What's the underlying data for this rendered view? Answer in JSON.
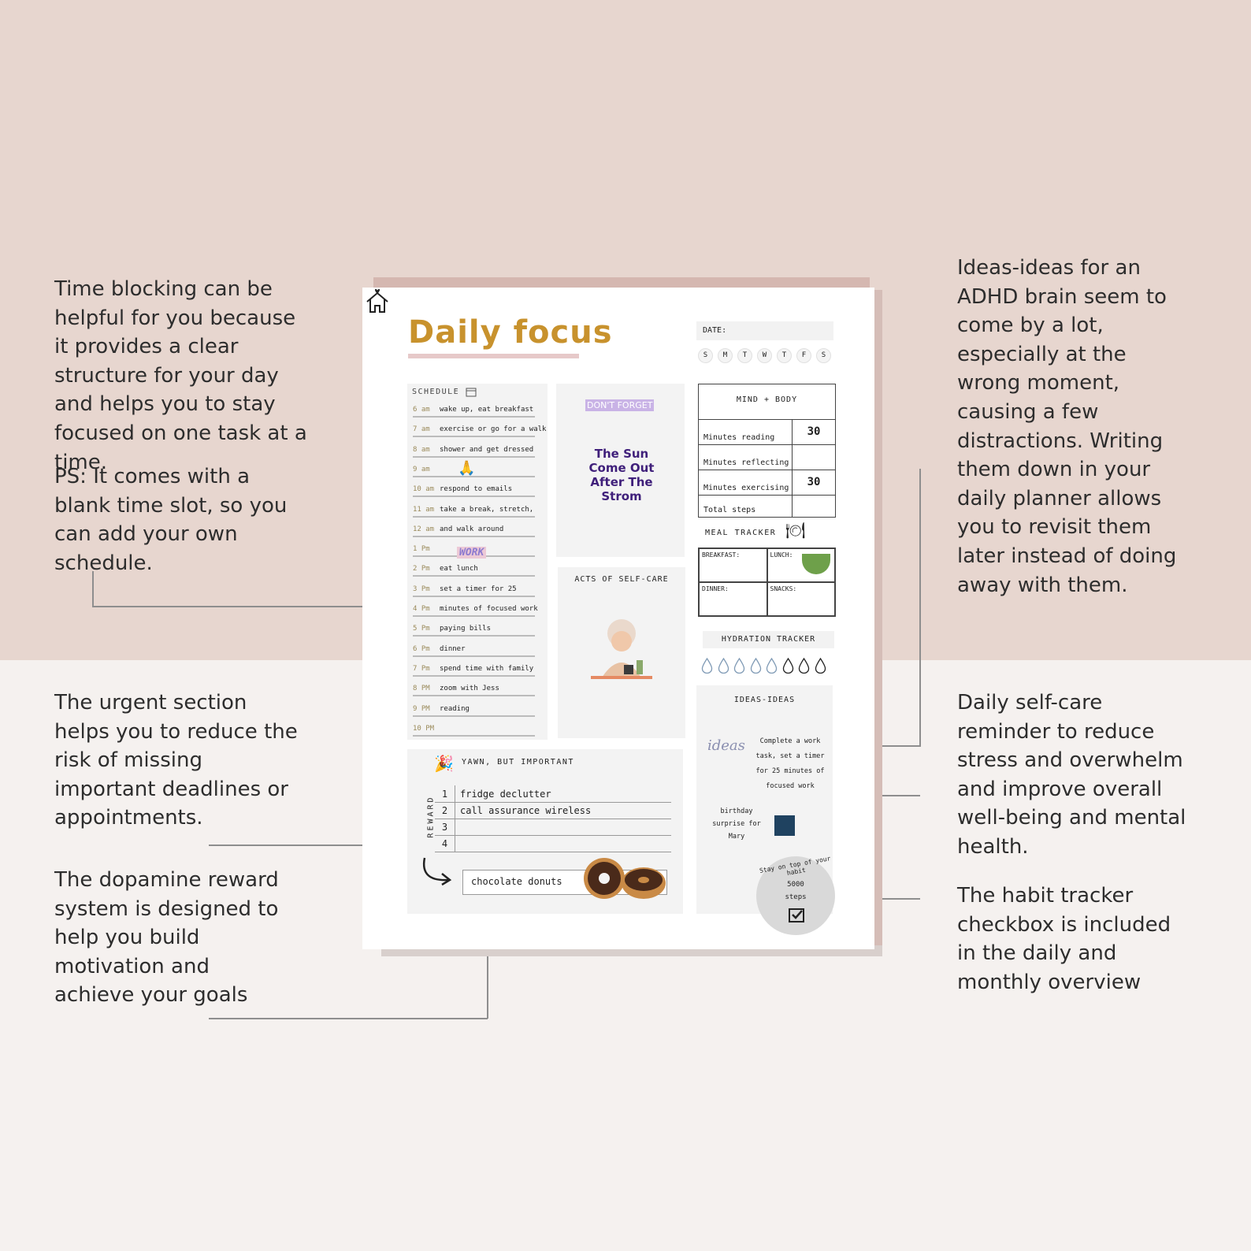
{
  "notes": {
    "time_blocking": "Time blocking can be helpful for you because it provides a clear structure for your day and helps you to stay focused on one task at a time.",
    "ps": "PS: It comes with a blank time slot, so you can add your own schedule.",
    "urgent": "The urgent section helps you to reduce the risk of missing important deadlines or appointments.",
    "dopamine": "The dopamine reward system is designed to help you build motivation and achieve your goals",
    "ideas": "Ideas-ideas for an ADHD brain seem to come by a lot, especially at the wrong moment, causing a few distractions. Writing them down in your daily planner allows you to revisit them later instead of doing away with them.",
    "self_care": "Daily self-care reminder to reduce stress and overwhelm and improve overall well-being and mental health.",
    "habit": "The habit tracker checkbox is included in the daily and monthly overview"
  },
  "planner": {
    "title": "Daily focus",
    "date_label": "DATE:",
    "days": [
      "S",
      "M",
      "T",
      "W",
      "T",
      "F",
      "S"
    ],
    "schedule": {
      "label": "SCHEDULE",
      "rows": [
        {
          "time": "6 am",
          "task": "wake up, eat breakfast"
        },
        {
          "time": "7 am",
          "task": "exercise or go for a walk"
        },
        {
          "time": "8 am",
          "task": "shower and get dressed"
        },
        {
          "time": "9 am",
          "task": ""
        },
        {
          "time": "10 am",
          "task": "respond to emails"
        },
        {
          "time": "11 am",
          "task": "take a break, stretch,"
        },
        {
          "time": "12 am",
          "task": "and walk around"
        },
        {
          "time": "1 Pm",
          "task": ""
        },
        {
          "time": "2 Pm",
          "task": "eat lunch"
        },
        {
          "time": "3 Pm",
          "task": "set a timer for 25"
        },
        {
          "time": "4 Pm",
          "task": "minutes of focused work"
        },
        {
          "time": "5 Pm",
          "task": "paying bills"
        },
        {
          "time": "6 Pm",
          "task": "dinner"
        },
        {
          "time": "7 Pm",
          "task": "spend time with family"
        },
        {
          "time": "8 PM",
          "task": "zoom with Jess"
        },
        {
          "time": "9 PM",
          "task": "reading"
        },
        {
          "time": "10 PM",
          "task": ""
        }
      ],
      "work_sticker": "WORK"
    },
    "dont_forget": {
      "label": "DON'T FORGET",
      "quote": "The Sun Come Out After The Strom"
    },
    "self_care": {
      "label": "ACTS OF SELF-CARE"
    },
    "mind_body": {
      "label": "MIND + BODY",
      "rows": [
        {
          "label": "Minutes reading",
          "value": "30"
        },
        {
          "label": "Minutes reflecting",
          "value": ""
        },
        {
          "label": "Minutes exercising",
          "value": "30"
        },
        {
          "label": "Total steps",
          "value": ""
        }
      ]
    },
    "meal": {
      "label": "MEAL TRACKER",
      "cells": [
        "BREAKFAST:",
        "LUNCH:",
        "DINNER:",
        "SNACKS:"
      ]
    },
    "hydration": {
      "label": "HYDRATION TRACKER",
      "filled": 5,
      "total": 8
    },
    "ideas": {
      "label": "IDEAS-IDEAS",
      "doodle": "ideas",
      "idea1": "Complete a work task, set a timer for 25 minutes of focused work",
      "idea2": "birthday surprise for Mary"
    },
    "habit": {
      "arc": "Stay on top of your habit",
      "value": "5000 steps",
      "checked": true
    },
    "urgent": {
      "label": "YAWN, BUT IMPORTANT",
      "side": "REWARD",
      "rows": [
        {
          "n": "1",
          "text": "fridge declutter"
        },
        {
          "n": "2",
          "text": "call assurance wireless"
        },
        {
          "n": "3",
          "text": ""
        },
        {
          "n": "4",
          "text": ""
        }
      ],
      "reward": "chocolate donuts"
    }
  }
}
